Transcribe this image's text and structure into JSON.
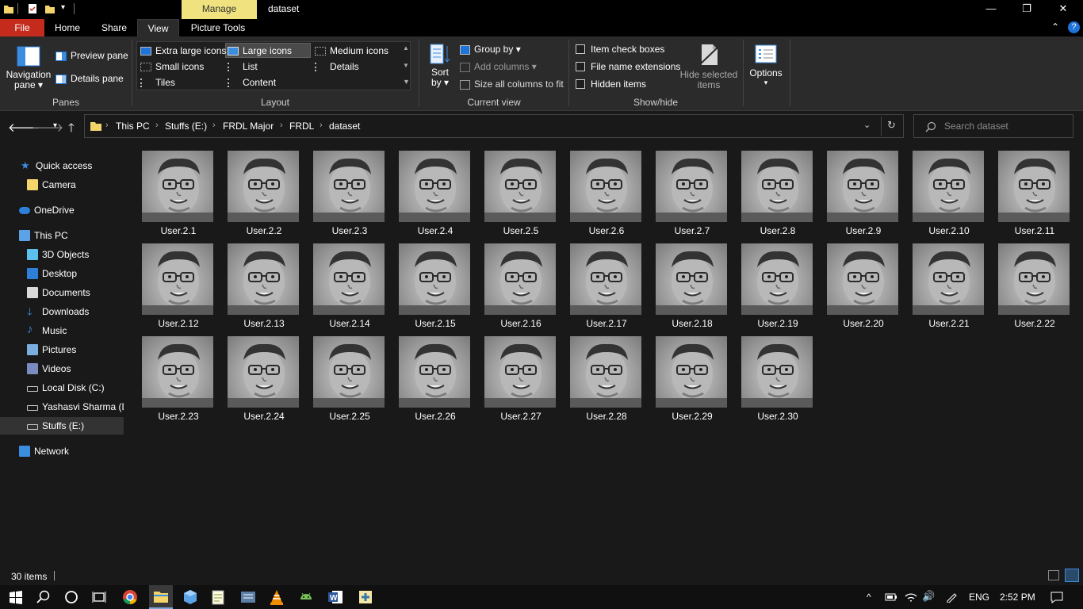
{
  "window": {
    "title": "dataset",
    "contextual_tab": "Manage",
    "minimize": "—",
    "restore": "❐",
    "close": "✕"
  },
  "ribbon": {
    "tabs": [
      "File",
      "Home",
      "Share",
      "View",
      "Picture Tools"
    ],
    "active_tab": "View",
    "panes": {
      "label": "Panes",
      "navigation_pane": "Navigation",
      "navigation_pane_2": "pane",
      "preview_pane": "Preview pane",
      "details_pane": "Details pane"
    },
    "layout": {
      "label": "Layout",
      "options": [
        "Extra large icons",
        "Large icons",
        "Medium icons",
        "Small icons",
        "List",
        "Details",
        "Tiles",
        "Content"
      ],
      "selected": "Large icons"
    },
    "current_view": {
      "label": "Current view",
      "sort_by": "Sort",
      "sort_by_2": "by",
      "group_by": "Group by",
      "add_columns": "Add columns",
      "size_columns": "Size all columns to fit"
    },
    "show_hide": {
      "label": "Show/hide",
      "item_check_boxes": "Item check boxes",
      "file_name_extensions": "File name extensions",
      "hidden_items": "Hidden items",
      "hide_selected": "Hide selected",
      "hide_selected_2": "items"
    },
    "options": "Options"
  },
  "address": {
    "breadcrumbs": [
      "This PC",
      "Stuffs (E:)",
      "FRDL Major",
      "FRDL",
      "dataset"
    ],
    "search_placeholder": "Search dataset"
  },
  "navpane": {
    "items": [
      {
        "label": "Quick access",
        "icon": "star-icon"
      },
      {
        "label": "Camera",
        "icon": "folder-icon"
      },
      {
        "label": "OneDrive",
        "icon": "cloud-icon"
      },
      {
        "label": "This PC",
        "icon": "computer-icon"
      },
      {
        "label": "3D Objects",
        "icon": "cube-icon"
      },
      {
        "label": "Desktop",
        "icon": "desktop-icon"
      },
      {
        "label": "Documents",
        "icon": "documents-icon"
      },
      {
        "label": "Downloads",
        "icon": "download-icon"
      },
      {
        "label": "Music",
        "icon": "music-icon"
      },
      {
        "label": "Pictures",
        "icon": "pictures-icon"
      },
      {
        "label": "Videos",
        "icon": "videos-icon"
      },
      {
        "label": "Local Disk (C:)",
        "icon": "drive-icon"
      },
      {
        "label": "Yashasvi Sharma (D:",
        "icon": "drive-icon"
      },
      {
        "label": "Stuffs (E:)",
        "icon": "drive-icon"
      },
      {
        "label": "Network",
        "icon": "network-icon"
      }
    ],
    "selected": "Stuffs (E:)"
  },
  "files": [
    "User.2.1",
    "User.2.2",
    "User.2.3",
    "User.2.4",
    "User.2.5",
    "User.2.6",
    "User.2.7",
    "User.2.8",
    "User.2.9",
    "User.2.10",
    "User.2.11",
    "User.2.12",
    "User.2.13",
    "User.2.14",
    "User.2.15",
    "User.2.16",
    "User.2.17",
    "User.2.18",
    "User.2.19",
    "User.2.20",
    "User.2.21",
    "User.2.22",
    "User.2.23",
    "User.2.24",
    "User.2.25",
    "User.2.26",
    "User.2.27",
    "User.2.28",
    "User.2.29",
    "User.2.30"
  ],
  "status": {
    "item_count": "30 items"
  },
  "taskbar": {
    "language": "ENG",
    "time": "2:52 PM"
  }
}
